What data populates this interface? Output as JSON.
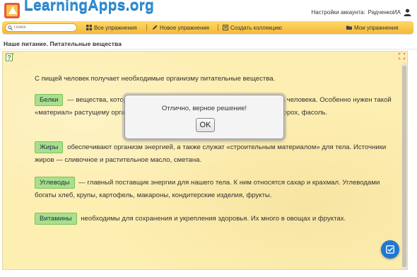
{
  "brand": {
    "name": "LearningApps.org"
  },
  "account": {
    "settings_label": "Настройки аккаунта:",
    "username": "РадченкоИА"
  },
  "nav": {
    "search_placeholder": "Поиск",
    "all_exercises": "Все упражнения",
    "new_exercise": "Новое упражнение",
    "create_collection": "Создать коллекцию",
    "my_exercises": "Мои упражнения"
  },
  "page": {
    "title": "Наше питание. Питательные вещества"
  },
  "exercise": {
    "intro": "С пищей человек получает необходимые организму питательные вещества.",
    "items": [
      {
        "tag": "Белки",
        "text": "— вещества, которые служат «строительным материалом» для тела человека. Особенно нужен такой «материал» растущему организму. Белками богаты творог, яйца, мясо, рыба, горох, фасоль."
      },
      {
        "tag": "Жиры",
        "text": "обеспечивают организм энергией, а также служат «строительным материалом» для тела. Источники жиров — сливочное и растительное масло, сметана."
      },
      {
        "tag": "Углеводы",
        "text": "— главный поставщик энергии для нашего тела. К ним относятся сахар и крахмал. Углеводами богаты хлеб, крупы, картофель, макароны, кондитерские изделия, фрукты."
      },
      {
        "tag": "Витамины",
        "text": "необходимы для сохранения и укрепления здоровья. Их много в овощах и фруктах."
      }
    ]
  },
  "dialog": {
    "message": "Отлично, верное решение!",
    "ok_label": "OK"
  },
  "colors": {
    "accent": "#f3b93a",
    "tag_bg": "#a8e08c",
    "panel_bg": "#fdeeb1",
    "fab": "#1e78d2"
  },
  "icons": [
    "logo-icon",
    "user-icon",
    "search-icon",
    "grid-icon",
    "pencil-icon",
    "collection-icon",
    "folder-icon",
    "help-icon",
    "expand-icon",
    "check-edit-icon"
  ]
}
